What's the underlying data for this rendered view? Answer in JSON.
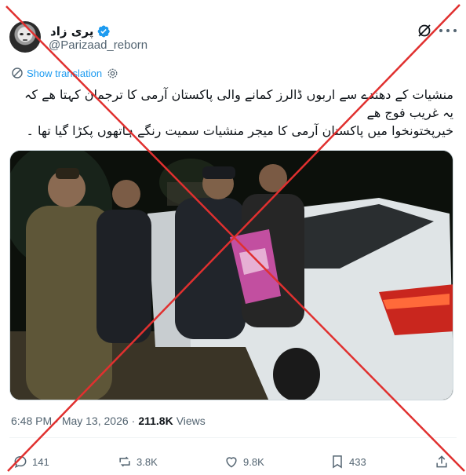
{
  "author": {
    "display_name": "پری زاد",
    "handle": "@Parizaad_reborn",
    "verified_color": "#1d9bf0"
  },
  "translate": {
    "label": "Show translation"
  },
  "tweet": {
    "lines": [
      "منشیات کے دھندے سے اربوں ڈالرز کمانے والی پاکستان آرمی کا ترجمان کہتا ھے کہ یہ غریب فوج ھے",
      "خیرپختونخوا میں پاکستان آرمی کا میجر منشیات سمیت رنگے ہاتھوں پکڑا گیا تھا ۔"
    ]
  },
  "meta": {
    "time": "6:48 PM",
    "separator": "·",
    "date": "May 13, 2026",
    "views_count": "211.8K",
    "views_label": "Views"
  },
  "actions": {
    "replies": "141",
    "reposts": "3.8K",
    "likes": "9.8K",
    "bookmarks": "433"
  },
  "colors": {
    "accent": "#1d9bf0",
    "secondary_text": "#536471",
    "overlay_x": "#e0302f"
  }
}
